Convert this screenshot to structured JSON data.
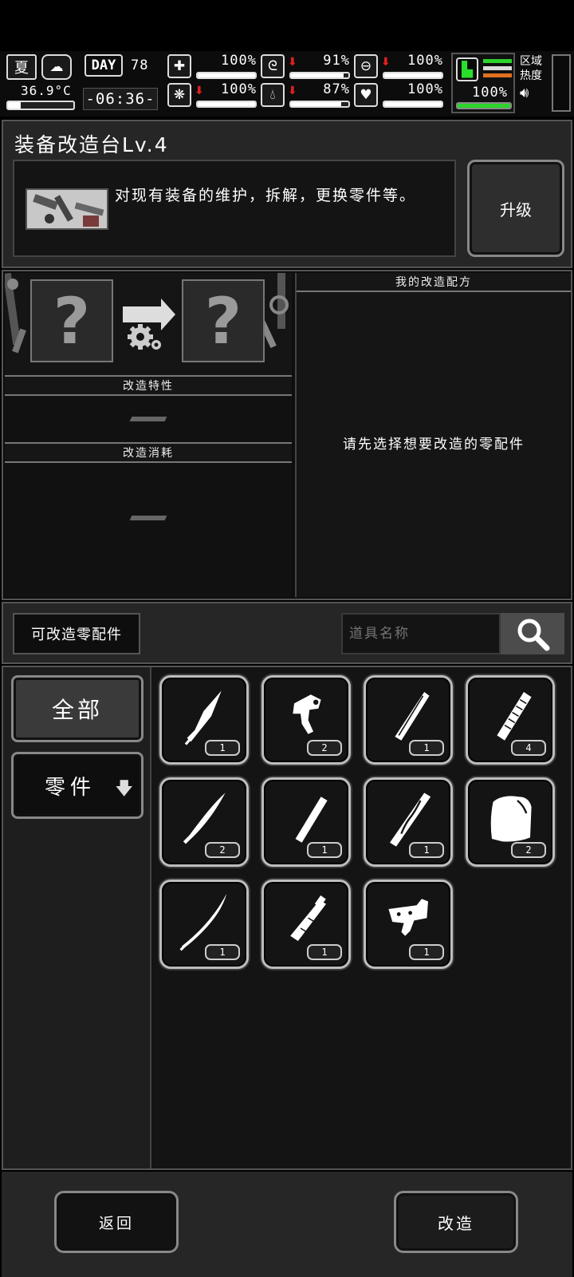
{
  "status": {
    "season": "夏",
    "temperature": "36.9°C",
    "day_label": "DAY",
    "day_number": "78",
    "clock": "-06:36-",
    "stats": [
      {
        "icon": "medkit-icon",
        "value": "100%",
        "fill": 1.0,
        "trend": ""
      },
      {
        "icon": "stomach-icon",
        "value": "91%",
        "fill": 0.91,
        "trend": "down"
      },
      {
        "icon": "shield-icon",
        "value": "100%",
        "fill": 1.0,
        "trend": "down"
      },
      {
        "icon": "brain-icon",
        "value": "100%",
        "fill": 1.0,
        "trend": "down"
      },
      {
        "icon": "water-drop-icon",
        "value": "87%",
        "fill": 0.87,
        "trend": "down"
      },
      {
        "icon": "heart-icon",
        "value": "100%",
        "fill": 1.0,
        "trend": ""
      }
    ],
    "stamina": {
      "value": "100%",
      "fill": 1.0
    },
    "region_heat_label": "区域热度"
  },
  "station": {
    "title": "装备改造台Lv.4",
    "description": "对现有装备的维护，拆解，更换零件等。",
    "upgrade_label": "升级"
  },
  "modify": {
    "trait_header": "改造特性",
    "cost_header": "改造消耗",
    "placeholder_mark": "?",
    "recipes_header": "我的改造配方",
    "recipes_hint": "请先选择想要改造的零配件"
  },
  "parts_bar": {
    "label": "可改造零配件",
    "search_placeholder": "道具名称"
  },
  "categories": [
    {
      "label": "全部"
    },
    {
      "label": "零件"
    }
  ],
  "items": [
    {
      "icon": "knife-blade-icon",
      "count": "1"
    },
    {
      "icon": "trigger-part-icon",
      "count": "2"
    },
    {
      "icon": "handle-bar-icon",
      "count": "1"
    },
    {
      "icon": "wrapped-grip-icon",
      "count": "4"
    },
    {
      "icon": "curved-blade-icon",
      "count": "2"
    },
    {
      "icon": "short-handle-icon",
      "count": "1"
    },
    {
      "icon": "carved-handle-icon",
      "count": "1"
    },
    {
      "icon": "cloth-bag-icon",
      "count": "2"
    },
    {
      "icon": "katana-blade-icon",
      "count": "1"
    },
    {
      "icon": "barrel-part-icon",
      "count": "1"
    },
    {
      "icon": "receiver-part-icon",
      "count": "1"
    }
  ],
  "footer": {
    "back_label": "返回",
    "modify_label": "改造"
  }
}
